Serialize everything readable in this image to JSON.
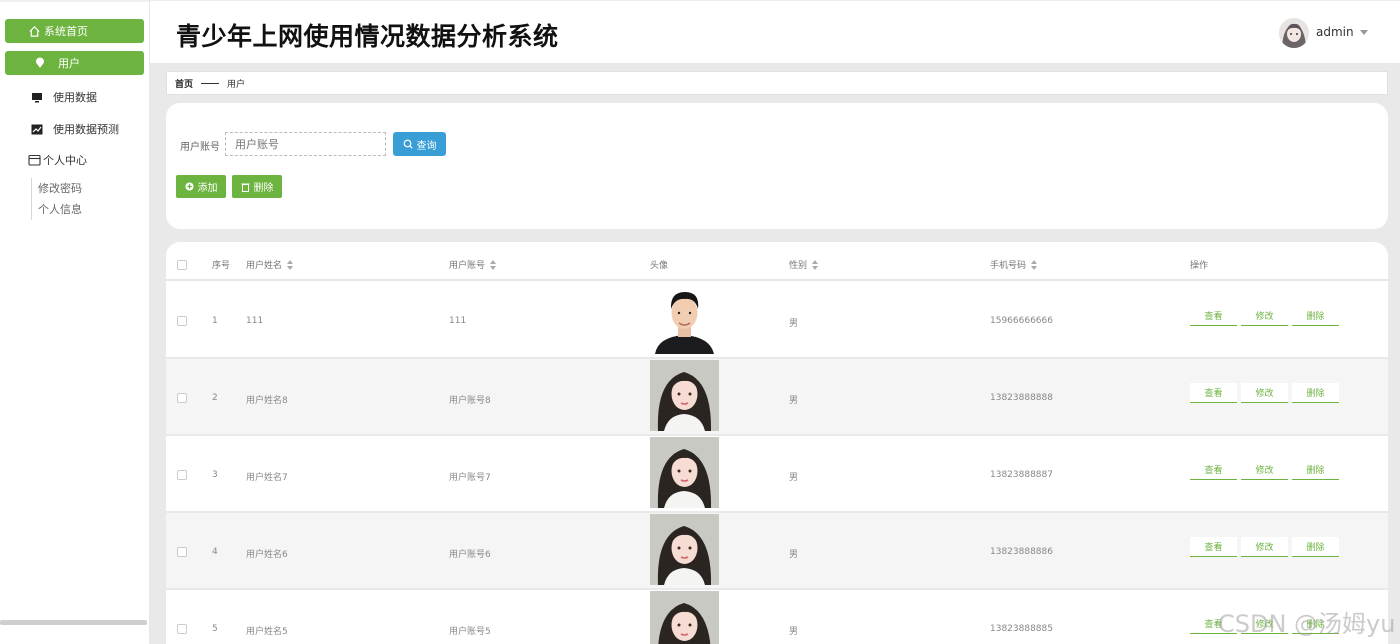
{
  "app": {
    "title": "青少年上网使用情况数据分析系统"
  },
  "header": {
    "username": "admin"
  },
  "sidebar": {
    "home": "系统首页",
    "items": [
      {
        "label": "用户"
      },
      {
        "label": "使用数据"
      },
      {
        "label": "使用数据预测"
      }
    ],
    "personal": {
      "label": "个人中心",
      "children": [
        "修改密码",
        "个人信息"
      ]
    }
  },
  "breadcrumb": {
    "home": "首页",
    "current": "用户"
  },
  "search": {
    "label": "用户账号",
    "placeholder": "用户账号",
    "query_label": "查询",
    "add_label": "添加",
    "delete_label": "删除"
  },
  "table": {
    "columns": {
      "index": "序号",
      "name": "用户姓名",
      "account": "用户账号",
      "avatar": "头像",
      "gender": "性别",
      "phone": "手机号码",
      "ops": "操作"
    },
    "rows": [
      {
        "index": "1",
        "name": "111",
        "account": "111",
        "gender": "男",
        "phone": "15966666666"
      },
      {
        "index": "2",
        "name": "用户姓名8",
        "account": "用户账号8",
        "gender": "男",
        "phone": "13823888888"
      },
      {
        "index": "3",
        "name": "用户姓名7",
        "account": "用户账号7",
        "gender": "男",
        "phone": "13823888887"
      },
      {
        "index": "4",
        "name": "用户姓名6",
        "account": "用户账号6",
        "gender": "男",
        "phone": "13823888886"
      },
      {
        "index": "5",
        "name": "用户姓名5",
        "account": "用户账号5",
        "gender": "男",
        "phone": "13823888885"
      }
    ],
    "actions": {
      "view": "查看",
      "edit": "修改",
      "delete": "删除"
    }
  },
  "watermark": "CSDN @汤姆yu",
  "colors": {
    "accent_green": "#6db33f",
    "query_blue": "#3a9ed6"
  }
}
